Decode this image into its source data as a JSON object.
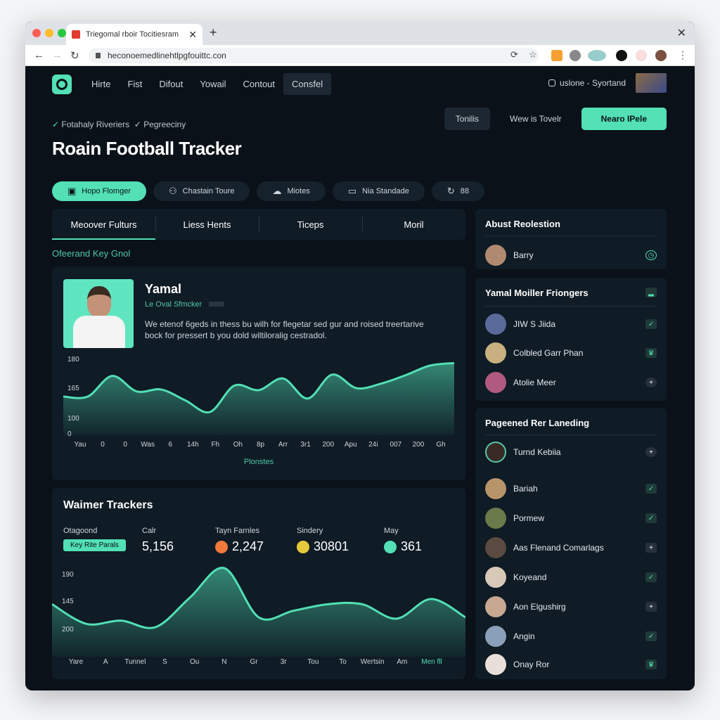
{
  "browser": {
    "tab_title": "Triegomal rboir Tocitiesram",
    "url": "heconoemedlinehtlpgfouittc.con"
  },
  "nav": {
    "items": [
      "Hirte",
      "Fist",
      "Difout",
      "Yowail",
      "Contout",
      "Consfel"
    ],
    "active": 5,
    "user_label": "uslone - Syortand"
  },
  "header": {
    "checks": [
      "Fotahaly Riveriers",
      "Pegreeciny"
    ],
    "title": "Roain Football Tracker",
    "buttons": {
      "secondary": "Tonilis",
      "ghost": "Wew is Tovelr",
      "primary": "Nearo IPele"
    }
  },
  "filters": [
    {
      "icon": "clipboard-icon",
      "glyph": "▣",
      "label": "Hopo Flomger",
      "active": true
    },
    {
      "icon": "user-icon",
      "glyph": "⚇",
      "label": "Chastain Toure"
    },
    {
      "icon": "cloud-icon",
      "glyph": "☁",
      "label": "Miotes"
    },
    {
      "icon": "tablet-icon",
      "glyph": "▭",
      "label": "Nia Standade"
    },
    {
      "icon": "refresh-icon",
      "glyph": "↻",
      "label": "88"
    }
  ],
  "tabs": [
    "Meoover Fulturs",
    "Liess Hents",
    "Ticeps",
    "Moril"
  ],
  "section_label": "Ofeerand Key Gnol",
  "player": {
    "name": "Yamal",
    "role": "Le Oval Sfmcker",
    "description": "We etenof 6geds in thess bu wilh for flegetar sed gur and roised treertarive bock for pressert b you dold wiltiloralig cestradol."
  },
  "stats_card": {
    "title": "Waimer Trackers",
    "stats": [
      {
        "label": "Otagoond",
        "badge": "Key Rite Parals"
      },
      {
        "label": "Calr",
        "value": "5,156"
      },
      {
        "label": "Tayn Farnles",
        "value": "2,247",
        "color": "#ef7a3b"
      },
      {
        "label": "Sindery",
        "value": "30801",
        "color": "#e6c93a"
      },
      {
        "label": "May",
        "value": "361",
        "color": "#52e0b4"
      }
    ]
  },
  "sidebar": {
    "panel1": {
      "title": "Abust Reolestion",
      "items": [
        {
          "name": "Barry",
          "action": "clock-icon"
        }
      ]
    },
    "panel2": {
      "title": "Yamal Moiller Friongers",
      "items": [
        {
          "name": "JIW S Jiida",
          "action": "check-icon"
        },
        {
          "name": "Colbled Garr Phan",
          "action": "crown-icon"
        },
        {
          "name": "Atolie Meer",
          "action": "plus-icon"
        }
      ]
    },
    "panel3": {
      "title": "Pageened Rer Laneding",
      "items": [
        {
          "name": "Turnd Kebiia",
          "action": "plus-icon"
        },
        {
          "name": "Bariah",
          "action": "check-icon"
        },
        {
          "name": "Pormew",
          "action": "check-icon"
        },
        {
          "name": "Aas Flenand Comarlags",
          "action": "plus-icon"
        },
        {
          "name": "Koyeand",
          "action": "check-icon"
        },
        {
          "name": "Aon Elgushirg",
          "action": "plus-icon"
        },
        {
          "name": "Angin",
          "action": "check-icon"
        },
        {
          "name": "Onay Ror",
          "action": "crown-icon"
        }
      ]
    }
  },
  "chart_data": [
    {
      "type": "area",
      "title": "",
      "xlabel": "Plonstes",
      "ylabel": "",
      "y_tick_labels": [
        "180",
        "165",
        "100",
        "0"
      ],
      "categories": [
        "Yau",
        "0",
        "0",
        "Was",
        "6",
        "14h",
        "Fh",
        "Oh",
        "8p",
        "Arr",
        "3r1",
        "200",
        "Apu",
        "24i",
        "007",
        "200",
        "Gh"
      ],
      "values": [
        120,
        120,
        152,
        128,
        131,
        114,
        96,
        137,
        130,
        148,
        117,
        154,
        133,
        140,
        153,
        168,
        172
      ],
      "ylim": [
        60,
        180
      ],
      "color": "#52e0b4"
    },
    {
      "type": "area",
      "title": "",
      "xlabel": "",
      "ylabel": "",
      "y_tick_labels": [
        "190",
        "145",
        "200"
      ],
      "categories": [
        "Yare",
        "A",
        "Tunnel",
        "S",
        "Ou",
        "N",
        "Gr",
        "3r",
        "Tou",
        "To",
        "Wertsin",
        "Am",
        "Men fll"
      ],
      "values": [
        140,
        110,
        115,
        105,
        150,
        195,
        120,
        130,
        140,
        140,
        118,
        148,
        120
      ],
      "ylim": [
        60,
        210
      ],
      "color": "#52e0b4"
    }
  ]
}
